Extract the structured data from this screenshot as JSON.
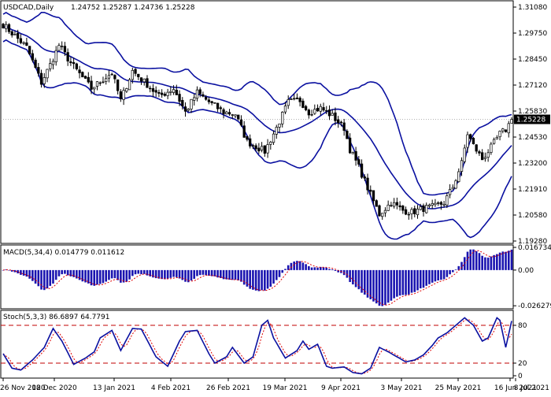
{
  "header": {
    "symbol": "USDCAD,Daily",
    "ohlc": "1.24752 1.25287 1.24736 1.25228"
  },
  "colors": {
    "price": "#000000",
    "bands": "#0a10a0",
    "macd_hist": "#1a14b0",
    "macd_signal": "#e00000",
    "stoch_main": "#0a10a0",
    "stoch_signal": "#e00000",
    "levels": "#c00000",
    "current_bg": "#000000",
    "current_text": "#ffffff"
  },
  "chart_data": [
    {
      "type": "candlestick",
      "panel": "price",
      "ylim": [
        1.1892,
        1.3126
      ],
      "yticks": [
        "1.31080",
        "1.29750",
        "1.28450",
        "1.27120",
        "1.25830",
        "1.24530",
        "1.23200",
        "1.21910",
        "1.20580",
        "1.19280"
      ],
      "current_price": "1.25228",
      "xticks": [
        "26 Nov 2020",
        "18 Dec 2020",
        "13 Jan 2021",
        "4 Feb 2021",
        "26 Feb 2021",
        "19 Mar 2021",
        "9 Apr 2021",
        "3 May 2021",
        "25 May 2021",
        "16 Jun 2021",
        "8 Jul 2021"
      ],
      "close_anchors": [
        [
          0,
          1.3005
        ],
        [
          8,
          1.289
        ],
        [
          13,
          1.271
        ],
        [
          16,
          1.28
        ],
        [
          19,
          1.29
        ],
        [
          23,
          1.281
        ],
        [
          30,
          1.268
        ],
        [
          37,
          1.276
        ],
        [
          40,
          1.262
        ],
        [
          44,
          1.277
        ],
        [
          49,
          1.27
        ],
        [
          53,
          1.264
        ],
        [
          58,
          1.268
        ],
        [
          62,
          1.256
        ],
        [
          66,
          1.266
        ],
        [
          71,
          1.26
        ],
        [
          75,
          1.256
        ],
        [
          79,
          1.255
        ],
        [
          83,
          1.241
        ],
        [
          89,
          1.236
        ],
        [
          93,
          1.248
        ],
        [
          97,
          1.261
        ],
        [
          101,
          1.262
        ],
        [
          104,
          1.256
        ],
        [
          108,
          1.258
        ],
        [
          112,
          1.254
        ],
        [
          116,
          1.248
        ],
        [
          118,
          1.237
        ],
        [
          121,
          1.228
        ],
        [
          125,
          1.214
        ],
        [
          128,
          1.204
        ],
        [
          132,
          1.21
        ],
        [
          136,
          1.206
        ],
        [
          139,
          1.205
        ],
        [
          143,
          1.207
        ],
        [
          147,
          1.208
        ],
        [
          150,
          1.21
        ],
        [
          153,
          1.218
        ],
        [
          156,
          1.23
        ],
        [
          158,
          1.245
        ],
        [
          160,
          1.239
        ],
        [
          163,
          1.232
        ],
        [
          166,
          1.238
        ],
        [
          169,
          1.245
        ],
        [
          171,
          1.247
        ],
        [
          173,
          1.2523
        ]
      ],
      "bands_note": "Bollinger bands plotted from candle data"
    },
    {
      "type": "bar",
      "panel": "macd",
      "title": "MACD(5,34,4) 0.014779 0.011612",
      "ylim": [
        -0.0285,
        0.0185
      ],
      "yticks": [
        "0.016734",
        "0.00",
        "-0.026279"
      ]
    },
    {
      "type": "line",
      "panel": "stochastic",
      "title": "Stoch(5,3,3) 86.6897 64.7791",
      "ylim": [
        0,
        100
      ],
      "yticks": [
        "80",
        "20",
        "0"
      ],
      "levels": [
        80,
        20
      ],
      "main_anchors": [
        [
          0,
          35
        ],
        [
          3,
          12
        ],
        [
          6,
          9
        ],
        [
          10,
          25
        ],
        [
          14,
          45
        ],
        [
          17,
          75
        ],
        [
          20,
          55
        ],
        [
          24,
          18
        ],
        [
          28,
          28
        ],
        [
          31,
          38
        ],
        [
          33,
          60
        ],
        [
          37,
          72
        ],
        [
          40,
          40
        ],
        [
          44,
          75
        ],
        [
          47,
          74
        ],
        [
          52,
          30
        ],
        [
          56,
          15
        ],
        [
          60,
          55
        ],
        [
          62,
          70
        ],
        [
          66,
          72
        ],
        [
          70,
          35
        ],
        [
          72,
          20
        ],
        [
          76,
          30
        ],
        [
          78,
          45
        ],
        [
          82,
          20
        ],
        [
          85,
          30
        ],
        [
          88,
          80
        ],
        [
          90,
          88
        ],
        [
          92,
          60
        ],
        [
          96,
          28
        ],
        [
          100,
          40
        ],
        [
          102,
          55
        ],
        [
          104,
          42
        ],
        [
          107,
          50
        ],
        [
          110,
          15
        ],
        [
          112,
          12
        ],
        [
          116,
          14
        ],
        [
          119,
          5
        ],
        [
          122,
          3
        ],
        [
          125,
          12
        ],
        [
          128,
          45
        ],
        [
          131,
          38
        ],
        [
          134,
          30
        ],
        [
          137,
          22
        ],
        [
          140,
          25
        ],
        [
          143,
          33
        ],
        [
          146,
          48
        ],
        [
          148,
          60
        ],
        [
          151,
          68
        ],
        [
          154,
          80
        ],
        [
          157,
          92
        ],
        [
          160,
          80
        ],
        [
          163,
          55
        ],
        [
          165,
          60
        ],
        [
          168,
          92
        ],
        [
          169,
          88
        ],
        [
          171,
          45
        ],
        [
          173,
          87
        ]
      ]
    }
  ]
}
